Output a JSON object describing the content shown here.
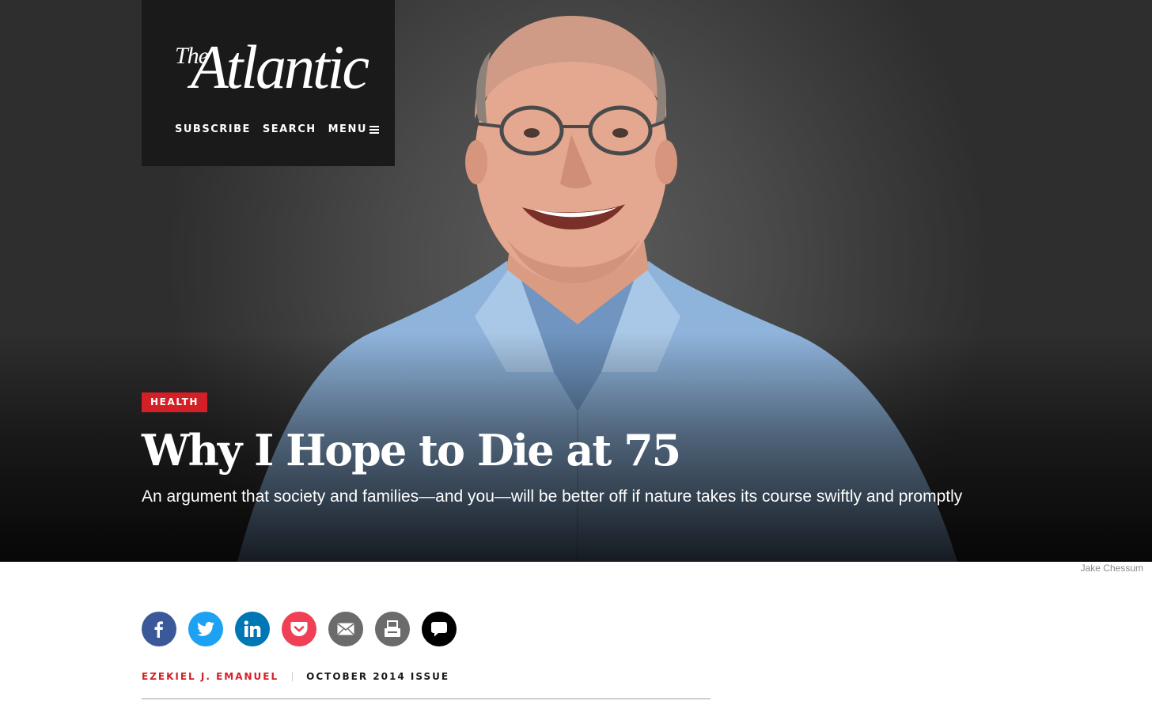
{
  "brand": {
    "logo_the": "The",
    "logo_main": "Atlantic",
    "nav": {
      "subscribe": "SUBSCRIBE",
      "search": "SEARCH",
      "menu": "MENU"
    }
  },
  "article": {
    "section": "HEALTH",
    "headline": "Why I Hope to Die at 75",
    "dek": "An argument that society and families—and you—will be better off if nature takes its course swiftly and promptly",
    "photo_credit": "Jake Chessum",
    "author": "EZEKIEL J. EMANUEL",
    "issue": "OCTOBER 2014 ISSUE"
  },
  "share": [
    {
      "icon": "facebook-icon",
      "color": "#3b5998"
    },
    {
      "icon": "twitter-icon",
      "color": "#1da1f2"
    },
    {
      "icon": "linkedin-icon",
      "color": "#0077b5"
    },
    {
      "icon": "pocket-icon",
      "color": "#ef4056"
    },
    {
      "icon": "email-icon",
      "color": "#6b6b6b"
    },
    {
      "icon": "print-icon",
      "color": "#6b6b6b"
    },
    {
      "icon": "comment-icon",
      "color": "#000000"
    }
  ],
  "colors": {
    "accent_red": "#d31f26",
    "brand_box": "#1a1a1a",
    "shirt_blue": "#8fb4dc"
  }
}
